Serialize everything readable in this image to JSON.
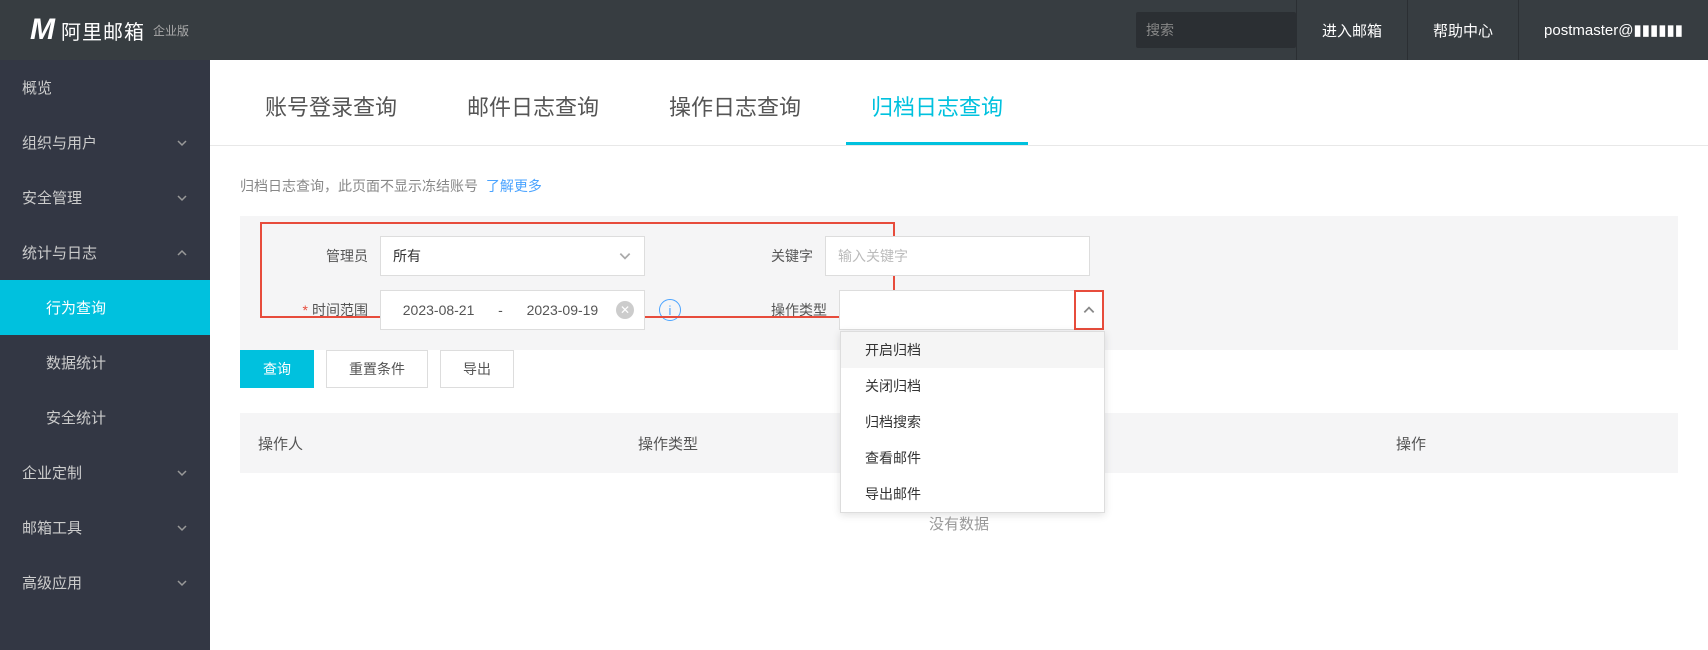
{
  "header": {
    "logo_main": "阿里邮箱",
    "logo_sub": "企业版",
    "search_placeholder": "搜索",
    "link_enter_mail": "进入邮箱",
    "link_help": "帮助中心",
    "user_email": "postmaster@▮▮▮▮▮▮"
  },
  "sidebar": {
    "items": [
      {
        "label": "概览",
        "expandable": false
      },
      {
        "label": "组织与用户",
        "expandable": true,
        "open": false
      },
      {
        "label": "安全管理",
        "expandable": true,
        "open": false
      },
      {
        "label": "统计与日志",
        "expandable": true,
        "open": true
      },
      {
        "label": "行为查询",
        "sub": true,
        "active": true
      },
      {
        "label": "数据统计",
        "sub": true
      },
      {
        "label": "安全统计",
        "sub": true
      },
      {
        "label": "企业定制",
        "expandable": true,
        "open": false
      },
      {
        "label": "邮箱工具",
        "expandable": true,
        "open": false
      },
      {
        "label": "高级应用",
        "expandable": true,
        "open": false
      }
    ]
  },
  "tabs": [
    {
      "label": "账号登录查询"
    },
    {
      "label": "邮件日志查询"
    },
    {
      "label": "操作日志查询"
    },
    {
      "label": "归档日志查询",
      "active": true
    }
  ],
  "notice": {
    "text": "归档日志查询，此页面不显示冻结账号",
    "link": "了解更多"
  },
  "form": {
    "admin_label": "管理员",
    "admin_value": "所有",
    "time_label": "时间范围",
    "date_start": "2023-08-21",
    "date_sep": "-",
    "date_end": "2023-09-19",
    "keyword_label": "关键字",
    "keyword_placeholder": "输入关键字",
    "optype_label": "操作类型",
    "optype_value": "",
    "optype_options": [
      "开启归档",
      "关闭归档",
      "归档搜索",
      "查看邮件",
      "导出邮件"
    ]
  },
  "buttons": {
    "query": "查询",
    "reset": "重置条件",
    "export": "导出"
  },
  "table": {
    "col_operator": "操作人",
    "col_optype": "操作类型",
    "col_action": "操作",
    "empty": "没有数据"
  }
}
